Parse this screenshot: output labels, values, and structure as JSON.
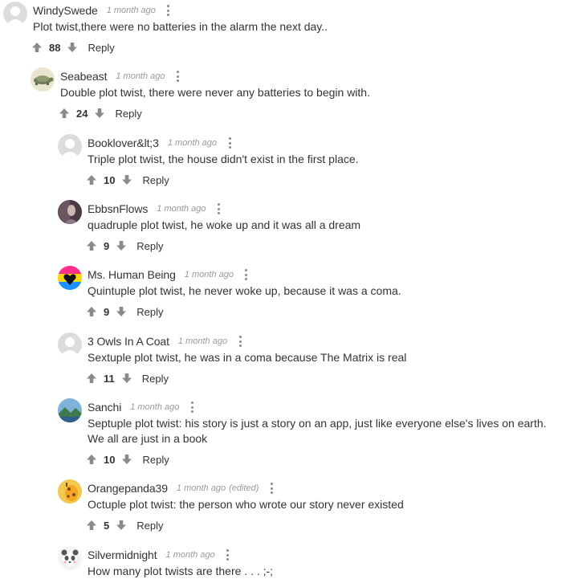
{
  "comments": [
    {
      "author": "WindySwede",
      "time": "1 month ago",
      "edited": "",
      "text": "Plot twist,there were no batteries in the alarm the next day..",
      "votes": "88",
      "reply": "Reply",
      "avatar": "default-avatar"
    },
    {
      "author": "Seabeast",
      "time": "1 month ago",
      "edited": "",
      "text": "Double plot twist, there were never any batteries to begin with.",
      "votes": "24",
      "reply": "Reply",
      "avatar": "turtle-avatar"
    },
    {
      "author": "Booklover&lt;3",
      "time": "1 month ago",
      "edited": "",
      "text": "Triple plot twist, the house didn't exist in the first place.",
      "votes": "10",
      "reply": "Reply",
      "avatar": "default-avatar"
    },
    {
      "author": "EbbsnFlows",
      "time": "1 month ago",
      "edited": "",
      "text": "quadruple plot twist, he woke up and it was all a dream",
      "votes": "9",
      "reply": "Reply",
      "avatar": "photo-avatar"
    },
    {
      "author": "Ms. Human Being",
      "time": "1 month ago",
      "edited": "",
      "text": "Quintuple plot twist, he never woke up, because it was a coma.",
      "votes": "9",
      "reply": "Reply",
      "avatar": "heart-flag-avatar"
    },
    {
      "author": "3 Owls In A Coat",
      "time": "1 month ago",
      "edited": "",
      "text": "Sextuple plot twist, he was in a coma because The Matrix is real",
      "votes": "11",
      "reply": "Reply",
      "avatar": "default-avatar"
    },
    {
      "author": "Sanchi",
      "time": "1 month ago",
      "edited": "",
      "text": "Septuple plot twist: his story is just a story on an app, just like everyone else's lives on earth. We all are just in a book",
      "votes": "10",
      "reply": "Reply",
      "avatar": "landscape-avatar"
    },
    {
      "author": "Orangepanda39",
      "time": "1 month ago",
      "edited": "(edited)",
      "text": "Octuple plot twist: the person who wrote our story never existed",
      "votes": "5",
      "reply": "Reply",
      "avatar": "giraffe-avatar"
    },
    {
      "author": "Silvermidnight",
      "time": "1 month ago",
      "edited": "",
      "text": "How many plot twists are there . . . ;-;",
      "votes": "",
      "reply": "",
      "avatar": "panda-avatar"
    }
  ],
  "colors": {
    "text": "#333333",
    "meta": "#999999",
    "icon": "#8a8a8a"
  }
}
